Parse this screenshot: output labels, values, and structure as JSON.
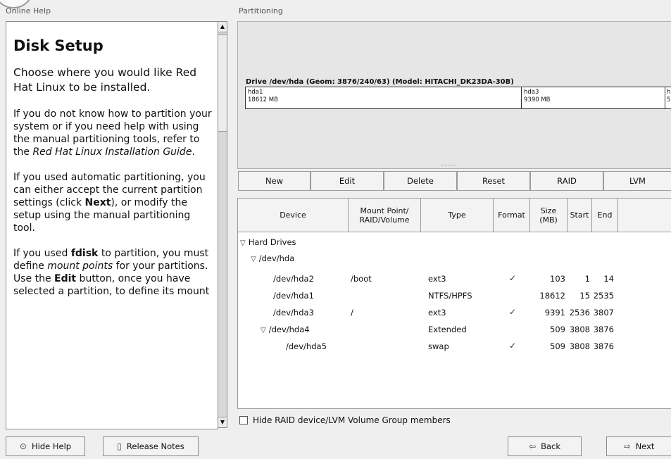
{
  "online_help_label": "Online Help",
  "partitioning_label": "Partitioning",
  "help": {
    "title": "Disk Setup",
    "p1": "Choose where you would like Red Hat Linux to be installed.",
    "p2a": "If you do not know how to partition your system or if you need help with using the manual partitioning tools, refer to the ",
    "p2b": "Red Hat Linux Installation Guide",
    "p2c": ".",
    "p3a": "If you used automatic partitioning, you can either accept the current partition settings (click ",
    "p3b": "Next",
    "p3c": "), or modify the setup using the manual partitioning tool.",
    "p4a": "If you used ",
    "p4b": "fdisk",
    "p4c": " to partition, you must define ",
    "p4d": "mount points",
    "p4e": " for your partitions. Use the ",
    "p4f": "Edit",
    "p4g": " button, once you have selected a partition, to define its mount"
  },
  "drive": {
    "label": "Drive /dev/hda (Geom: 3876/240/63) (Model: HITACHI_DK23DA-30B)",
    "seg1_name": "hda1",
    "seg1_size": "18612 MB",
    "seg2_name": "hda3",
    "seg2_size": "9390 MB",
    "seg3_name": "h",
    "seg3_size": "5"
  },
  "toolbar": {
    "new": "New",
    "edit": "Edit",
    "delete": "Delete",
    "reset": "Reset",
    "raid": "RAID",
    "lvm": "LVM"
  },
  "table": {
    "headers": [
      "Device",
      "Mount Point/\nRAID/Volume",
      "Type",
      "Format",
      "Size\n(MB)",
      "Start",
      "End"
    ],
    "group_hard_drives": "Hard Drives",
    "group_hda": "/dev/hda",
    "rows": [
      {
        "device": "/dev/hda2",
        "mount": "/boot",
        "type": "ext3",
        "format": "✓",
        "size": "103",
        "start": "1",
        "end": "14"
      },
      {
        "device": "/dev/hda1",
        "mount": "",
        "type": "NTFS/HPFS",
        "format": "",
        "size": "18612",
        "start": "15",
        "end": "2535"
      },
      {
        "device": "/dev/hda3",
        "mount": "/",
        "type": "ext3",
        "format": "✓",
        "size": "9391",
        "start": "2536",
        "end": "3807"
      },
      {
        "device": "/dev/hda4",
        "mount": "",
        "type": "Extended",
        "format": "",
        "size": "509",
        "start": "3808",
        "end": "3876"
      },
      {
        "device": "/dev/hda5",
        "mount": "",
        "type": "swap",
        "format": "✓",
        "size": "509",
        "start": "3808",
        "end": "3876"
      }
    ]
  },
  "hide_members_label": "Hide RAID device/LVM Volume Group members",
  "buttons": {
    "hide_help": "Hide Help",
    "release_notes": "Release Notes",
    "back": "Back",
    "next": "Next"
  }
}
